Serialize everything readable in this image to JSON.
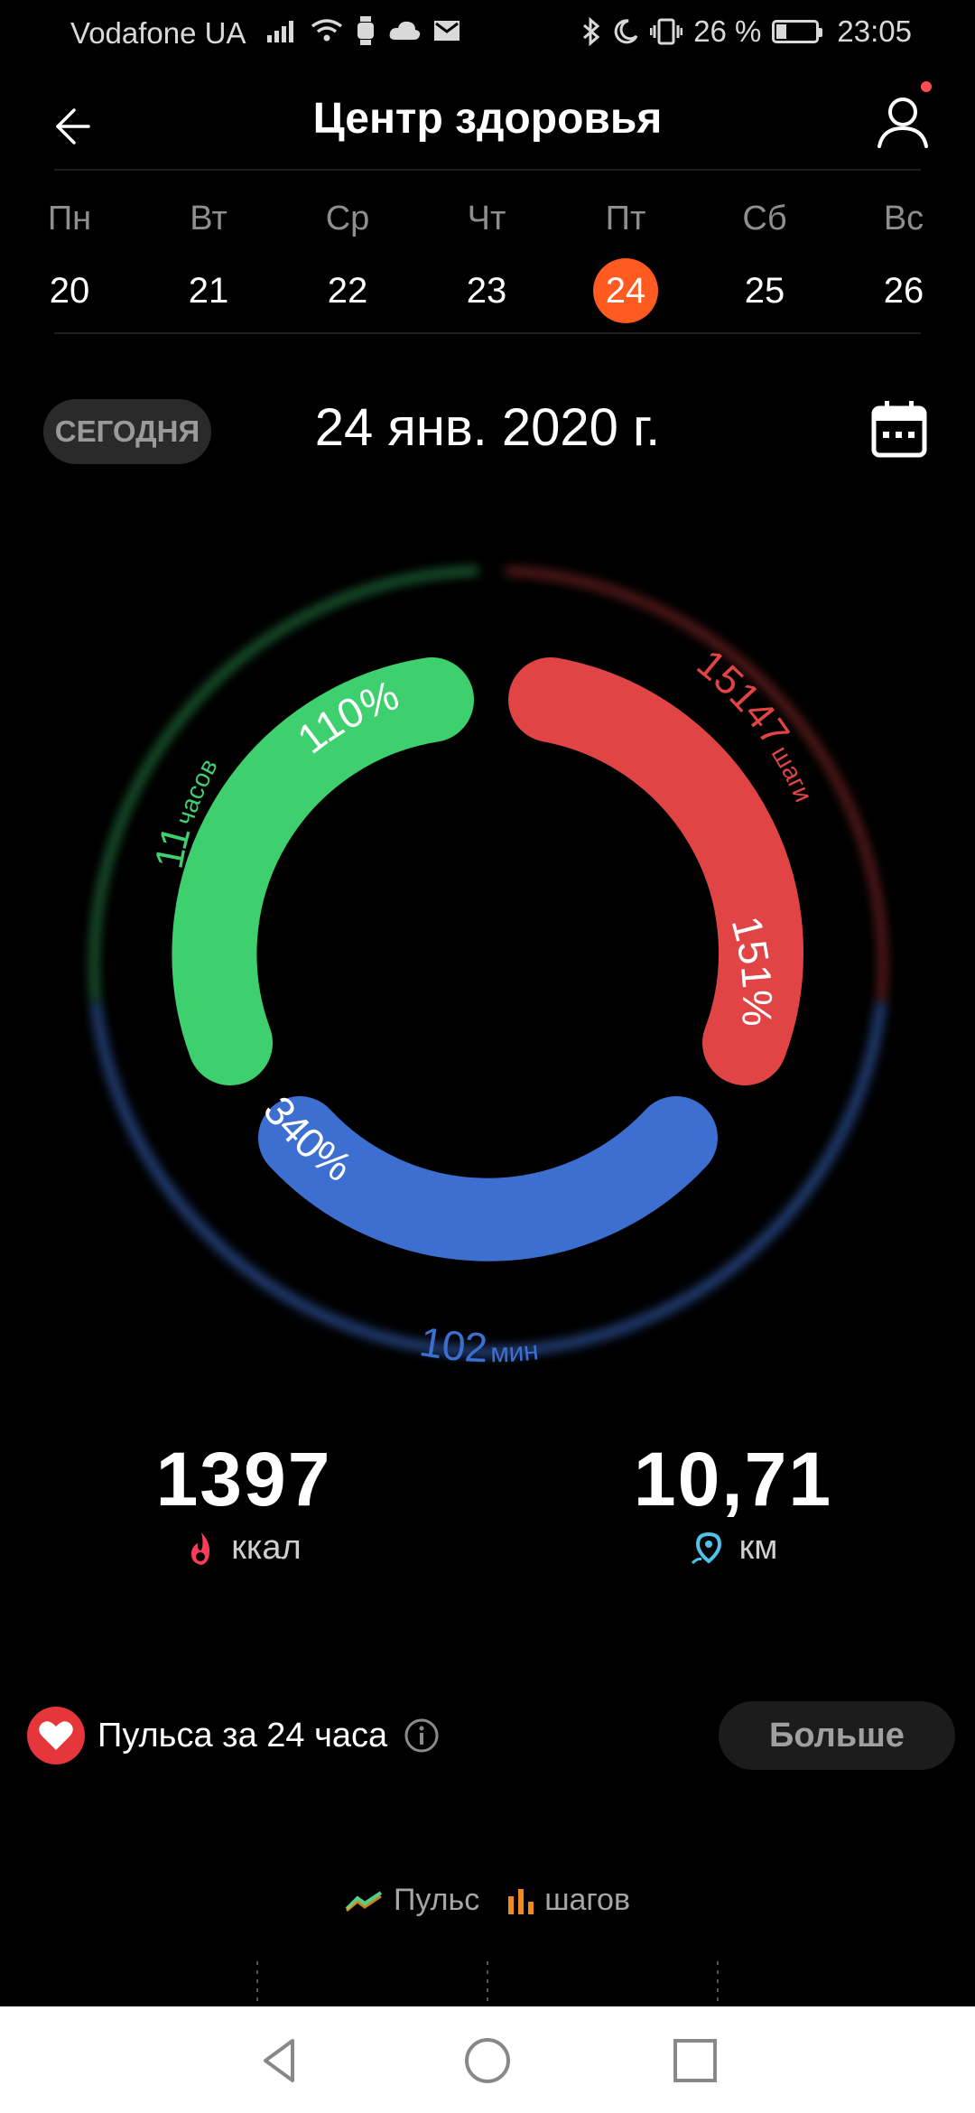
{
  "status_bar": {
    "carrier": "Vodafone UA",
    "battery": "26 %",
    "battery_level": 0.26,
    "time": "23:05",
    "icons": [
      "signal-icon",
      "wifi-icon",
      "watch-icon",
      "cloud-icon",
      "mail-icon",
      "bluetooth-icon",
      "moon-icon",
      "vibrate-icon",
      "battery-icon"
    ]
  },
  "header": {
    "back_icon": "back-arrow-icon",
    "title": "Центр здоровья",
    "profile_icon": "profile-icon"
  },
  "week": {
    "days": [
      {
        "name": "Пн",
        "date": "20"
      },
      {
        "name": "Вт",
        "date": "21"
      },
      {
        "name": "Ср",
        "date": "22"
      },
      {
        "name": "Чт",
        "date": "23"
      },
      {
        "name": "Пт",
        "date": "24",
        "selected": true
      },
      {
        "name": "Сб",
        "date": "25"
      },
      {
        "name": "Вс",
        "date": "26"
      }
    ],
    "selected_color": "#ff5a1f"
  },
  "date_row": {
    "today_label": "СЕГОДНЯ",
    "date": "24 янв. 2020 г.",
    "calendar_icon": "calendar-icon"
  },
  "rings": {
    "standing": {
      "value": "11",
      "unit": "часов",
      "percent": "110%",
      "color": "#3ecf6e"
    },
    "steps": {
      "value": "15147",
      "unit": "шаги",
      "percent": "151%",
      "color": "#e04444"
    },
    "exercise": {
      "value": "102",
      "unit": "мин",
      "percent": "340%",
      "color": "#3d6fd1"
    }
  },
  "stats": {
    "calories": {
      "value": "1397",
      "unit": "ккал",
      "icon": "flame-icon",
      "icon_color": "#ff3d5a"
    },
    "distance": {
      "value": "10,71",
      "unit": "км",
      "icon": "location-pin-icon",
      "icon_color": "#4fc3e8"
    }
  },
  "pulse": {
    "label": "Пульса за 24 часа",
    "heart_icon": "heart-icon",
    "info_icon": "info-icon",
    "more_label": "Больше"
  },
  "legend": {
    "pulse_label": "Пульс",
    "steps_label": "шагов"
  },
  "navbar": {
    "icons": [
      "nav-back-icon",
      "nav-home-icon",
      "nav-recents-icon"
    ]
  }
}
